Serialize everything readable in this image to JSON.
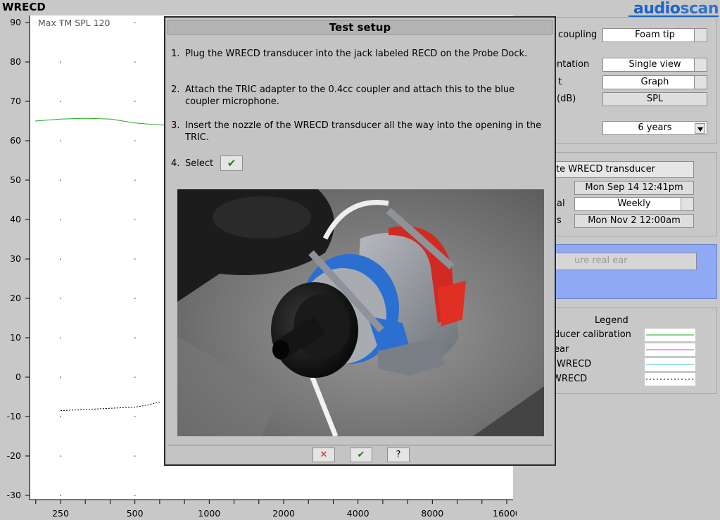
{
  "app": {
    "title": "WRECD",
    "brand_part1": "audio",
    "brand_part2": "scan"
  },
  "graph": {
    "annotation": "Max TM SPL 120",
    "y_ticks": [
      "90",
      "80",
      "70",
      "60",
      "50",
      "40",
      "30",
      "20",
      "10",
      "0",
      "-10",
      "-20",
      "-30"
    ],
    "x_ticks": [
      "250",
      "500",
      "1000",
      "2000",
      "4000",
      "8000",
      "16000"
    ]
  },
  "chart_data": {
    "type": "line",
    "y_range": [
      -30,
      90
    ],
    "x_scale": "log",
    "x_range": [
      200,
      16000
    ],
    "title": "",
    "series": [
      {
        "color": "#22aa22",
        "style": "solid",
        "x": [
          200,
          250,
          315,
          400,
          500,
          630,
          700
        ],
        "y": [
          65,
          65.5,
          65.7,
          65.5,
          64.5,
          64,
          64
        ]
      },
      {
        "color": "#000000",
        "style": "dotted",
        "x": [
          250,
          315,
          400,
          500,
          550,
          630
        ],
        "y": [
          -8.5,
          -8.2,
          -7.9,
          -7.6,
          -7.2,
          -6.3
        ]
      }
    ]
  },
  "right_panel": {
    "coupling": {
      "label": "coupling",
      "value": "Foam tip"
    },
    "presentation": {
      "label": "entation",
      "value": "Single view"
    },
    "format": {
      "label": "t",
      "value": "Graph"
    },
    "scale": {
      "label": "(dB)",
      "value": "SPL"
    },
    "age": {
      "value": "6 years"
    },
    "calibrate_button": "ate WRECD transducer",
    "last_calibrated": {
      "value": "Mon Sep 14 12:41pm"
    },
    "interval": {
      "label": "al",
      "value": "Weekly"
    },
    "next_due": {
      "label": "s",
      "value": "Mon Nov 2 12:00am"
    },
    "measure_button": "ure real ear",
    "legend": {
      "title": "Legend",
      "items": [
        {
          "label": "ducer calibration",
          "color": "#22aa22"
        },
        {
          "label": "ear",
          "color": "#cc44cc"
        },
        {
          "label": "WRECD",
          "color": "#33c6c6"
        },
        {
          "label": "WRECD",
          "color": "#000000"
        }
      ]
    }
  },
  "dialog": {
    "title": "Test setup",
    "steps": [
      {
        "num": "1.",
        "text": "Plug the WRECD transducer into the jack labeled RECD on the Probe Dock."
      },
      {
        "num": "2.",
        "text": "Attach the TRIC adapter to the 0.4cc coupler and attach this to the blue coupler microphone."
      },
      {
        "num": "3.",
        "text": "Insert the nozzle of the WRECD transducer all the way into the opening in the TRIC."
      },
      {
        "num": "4.",
        "text": "Select"
      }
    ],
    "select_check": "✔",
    "footer": {
      "cancel": "✕",
      "ok": "✔",
      "help": "?"
    }
  },
  "colors": {
    "accent": "#1a64c8",
    "measure_panel_bg": "#8fa9f5",
    "graph_bg": "#ffffff",
    "dialog_bg": "#c4c4c4"
  }
}
